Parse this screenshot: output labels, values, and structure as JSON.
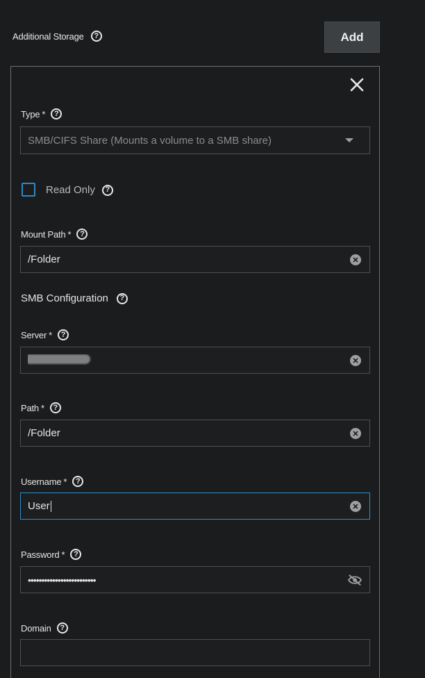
{
  "header": {
    "title": "Additional Storage",
    "add_label": "Add"
  },
  "form": {
    "type": {
      "label": "Type",
      "required": "*",
      "value": "SMB/CIFS Share (Mounts a volume to a SMB share)"
    },
    "read_only": {
      "label": "Read Only",
      "checked": false
    },
    "mount_path": {
      "label": "Mount Path",
      "required": "*",
      "value": "/Folder"
    },
    "smb_section": {
      "title": "SMB Configuration"
    },
    "server": {
      "label": "Server",
      "required": "*",
      "value": ""
    },
    "path": {
      "label": "Path",
      "required": "*",
      "value": "/Folder"
    },
    "username": {
      "label": "Username",
      "required": "*",
      "value": "User"
    },
    "password": {
      "label": "Password",
      "required": "*",
      "value": "•••••••••••••••••••••••••"
    },
    "domain": {
      "label": "Domain",
      "value": ""
    }
  },
  "icons": {
    "help": "?",
    "accent": "#2b8fd1"
  }
}
